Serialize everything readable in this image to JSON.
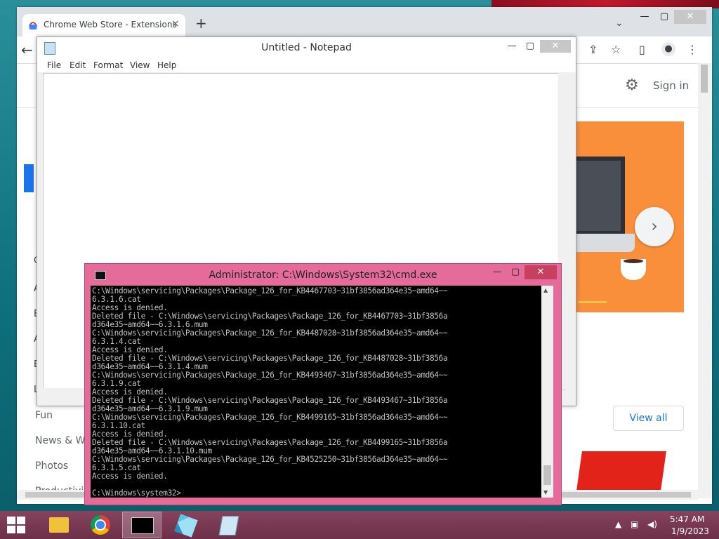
{
  "chrome": {
    "tab_title": "Chrome Web Store - Extensions",
    "tab_close": "×",
    "new_tab": "+",
    "tab_search": "⌄",
    "signin": "Sign in",
    "view_all": "View all",
    "left_letters": [
      "C",
      "A",
      "B",
      "A",
      "E",
      "L"
    ],
    "categories": [
      "Fun",
      "News & We",
      "Photos",
      "Productivity"
    ],
    "colors": {
      "accent": "#1a73e8",
      "hero": "#f98e3b"
    }
  },
  "notepad": {
    "title": "Untitled - Notepad",
    "menu": [
      "File",
      "Edit",
      "Format",
      "View",
      "Help"
    ]
  },
  "cmd": {
    "title": "Administrator: C:\\Windows\\System32\\cmd.exe",
    "lines": [
      "C:\\Windows\\servicing\\Packages\\Package_126_for_KB4467703~31bf3856ad364e35~amd64~~",
      "6.3.1.6.cat",
      "Access is denied.",
      "Deleted file - C:\\Windows\\servicing\\Packages\\Package_126_for_KB4467703~31bf3856a",
      "d364e35~amd64~~6.3.1.6.mum",
      "C:\\Windows\\servicing\\Packages\\Package_126_for_KB4487028~31bf3856ad364e35~amd64~~",
      "6.3.1.4.cat",
      "Access is denied.",
      "Deleted file - C:\\Windows\\servicing\\Packages\\Package_126_for_KB4487028~31bf3856a",
      "d364e35~amd64~~6.3.1.4.mum",
      "C:\\Windows\\servicing\\Packages\\Package_126_for_KB4493467~31bf3856ad364e35~amd64~~",
      "6.3.1.9.cat",
      "Access is denied.",
      "Deleted file - C:\\Windows\\servicing\\Packages\\Package_126_for_KB4493467~31bf3856a",
      "d364e35~amd64~~6.3.1.9.mum",
      "C:\\Windows\\servicing\\Packages\\Package_126_for_KB4499165~31bf3856ad364e35~amd64~~",
      "6.3.1.10.cat",
      "Access is denied.",
      "Deleted file - C:\\Windows\\servicing\\Packages\\Package_126_for_KB4499165~31bf3856a",
      "d364e35~amd64~~6.3.1.10.mum",
      "C:\\Windows\\servicing\\Packages\\Package_126_for_KB4525250~31bf3856ad364e35~amd64~~",
      "6.3.1.5.cat",
      "Access is denied.",
      "",
      "C:\\Windows\\system32>"
    ]
  },
  "taskbar": {
    "time": "5:47 AM",
    "date": "1/9/2023",
    "apps": [
      "file-explorer-icon",
      "chrome-icon",
      "cmd-icon",
      "cubes-icon",
      "notepad-icon"
    ]
  }
}
